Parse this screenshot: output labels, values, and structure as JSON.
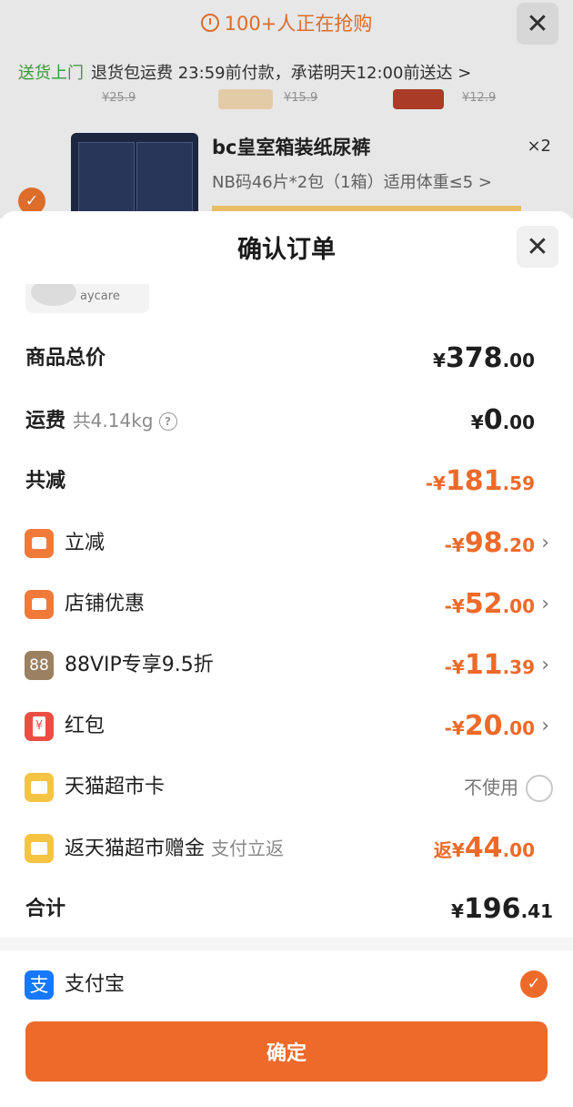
{
  "background": {
    "hot_text": "100+人正在抢购",
    "delivery_highlight": "送货上门",
    "delivery_text": "退货包运费 23:59前付款，承诺明天12:00前送达 >",
    "prev_prices": [
      "¥25.9",
      "¥15.9",
      "¥12.9"
    ],
    "product_title": "bc皇室箱装纸尿裤",
    "product_spec": "NB码46片*2包（1箱）适用体重≤5 >",
    "product_qty": "×2",
    "close_glyph": "✕",
    "check_glyph": "✓"
  },
  "sheet": {
    "title": "确认订单",
    "close_glyph": "✕",
    "thumb_brand": "aycare"
  },
  "summary": {
    "goods_total": {
      "label": "商品总价",
      "sign": "¥",
      "int": "378",
      "dec": ".00"
    },
    "shipping": {
      "label": "运费",
      "sub": "共4.14kg",
      "help": "?",
      "sign": "¥",
      "int": "0",
      "dec": ".00"
    },
    "total_discount": {
      "label": "共减",
      "sign": "-¥",
      "int": "181",
      "dec": ".59"
    }
  },
  "discounts": [
    {
      "icon": "shop-icon",
      "label": "立减",
      "sign": "-¥",
      "int": "98",
      "dec": ".20",
      "chevron": "›"
    },
    {
      "icon": "store-coupon-icon",
      "label": "店铺优惠",
      "sign": "-¥",
      "int": "52",
      "dec": ".00",
      "chevron": "›"
    },
    {
      "icon": "vip-88-icon",
      "icon_text": "88",
      "label": "88VIP专享9.5折",
      "sign": "-¥",
      "int": "11",
      "dec": ".39",
      "chevron": "›"
    },
    {
      "icon": "red-packet-icon",
      "label": "红包",
      "sign": "-¥",
      "int": "20",
      "dec": ".00",
      "chevron": "›"
    }
  ],
  "tmall_card": {
    "icon": "tmall-card-icon",
    "label": "天猫超市卡",
    "status": "不使用"
  },
  "cashback": {
    "icon": "tmall-gift-icon",
    "label": "返天猫超市赠金",
    "sub": "支付立返",
    "prefix": "返",
    "sign": "¥",
    "int": "44",
    "dec": ".00"
  },
  "total": {
    "label": "合计",
    "sign": "¥",
    "int": "196",
    "dec": ".41"
  },
  "payment": {
    "logo_text": "支",
    "label": "支付宝",
    "check_glyph": "✓"
  },
  "confirm_label": "确定",
  "colors": {
    "accent": "#ee6a2a",
    "alipay": "#1677ff",
    "vip": "#9b8061",
    "red_packet": "#ec4e43",
    "tmall": "#f5c442",
    "delivery_green": "#3aa33a"
  }
}
